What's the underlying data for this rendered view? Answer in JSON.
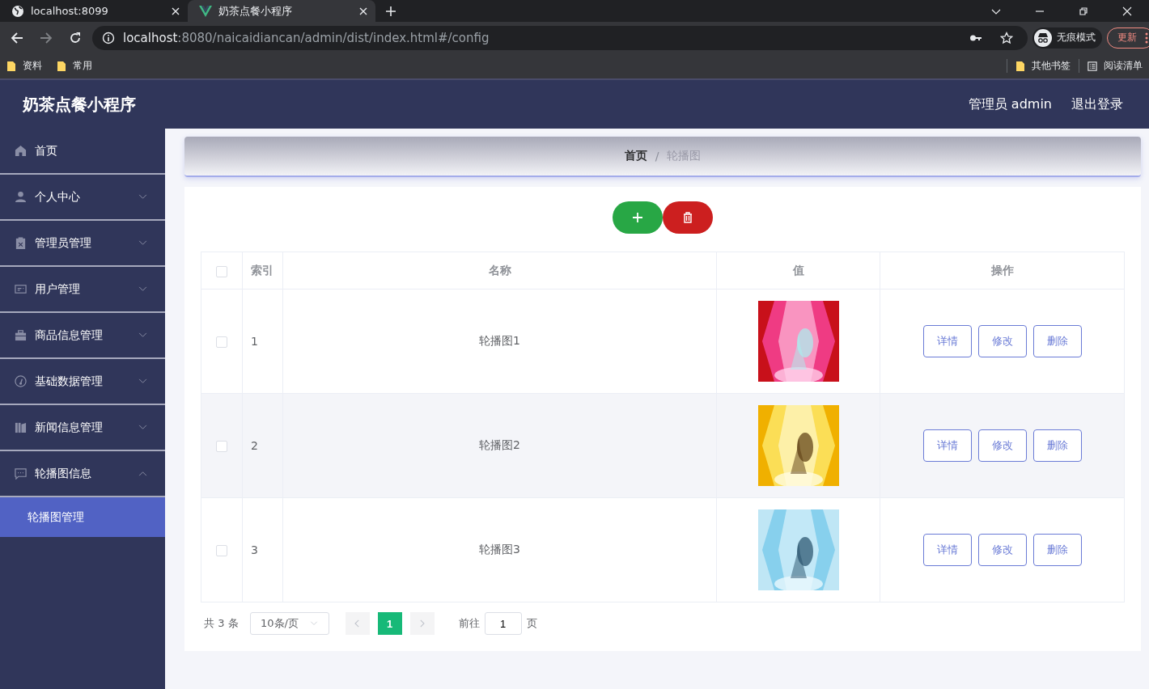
{
  "browser": {
    "tabs": [
      {
        "title": "localhost:8099",
        "selected": false
      },
      {
        "title": "奶茶点餐小程序",
        "selected": true
      }
    ],
    "url_host": "localhost",
    "url_rest": ":8080/naicaidiancan/admin/dist/index.html#/config",
    "profile": "无痕模式",
    "update": "更新",
    "bookmarks": [
      "资料",
      "常用"
    ],
    "bookmarks_right": [
      "其他书签",
      "阅读清单"
    ]
  },
  "app": {
    "title": "奶茶点餐小程序",
    "user": "管理员 admin",
    "logout": "退出登录"
  },
  "sidebar": {
    "items": [
      {
        "label": "首页"
      },
      {
        "label": "个人中心",
        "expanded": false
      },
      {
        "label": "管理员管理",
        "expanded": false
      },
      {
        "label": "用户管理",
        "expanded": false
      },
      {
        "label": "商品信息管理",
        "expanded": false
      },
      {
        "label": "基础数据管理",
        "expanded": false
      },
      {
        "label": "新闻信息管理",
        "expanded": false
      },
      {
        "label": "轮播图信息",
        "expanded": true,
        "children": [
          {
            "label": "轮播图管理",
            "selected": true
          }
        ]
      }
    ]
  },
  "breadcrumb": {
    "items": [
      "首页",
      "轮播图"
    ],
    "separator": "/"
  },
  "table": {
    "columns": [
      "索引",
      "名称",
      "值",
      "操作"
    ],
    "header_checked": false,
    "rows": [
      {
        "checked": false,
        "index": "1",
        "name": "轮播图1",
        "value": {
          "kind": "picture"
        },
        "actions": [
          "详情",
          "修改",
          "删除"
        ]
      },
      {
        "checked": false,
        "index": "2",
        "name": "轮播图2",
        "value": {
          "kind": "picture"
        },
        "actions": [
          "详情",
          "修改",
          "删除"
        ]
      },
      {
        "checked": false,
        "index": "3",
        "name": "轮播图3",
        "value": {
          "kind": "picture"
        },
        "actions": [
          "详情",
          "修改",
          "删除"
        ]
      }
    ]
  },
  "pagination": {
    "total": "共 3 条",
    "page_size": "10条/页",
    "pages": [
      {
        "label": "1",
        "selected": true
      }
    ],
    "goto_label": "前往",
    "goto_value": "1",
    "goto_suffix": "页"
  }
}
